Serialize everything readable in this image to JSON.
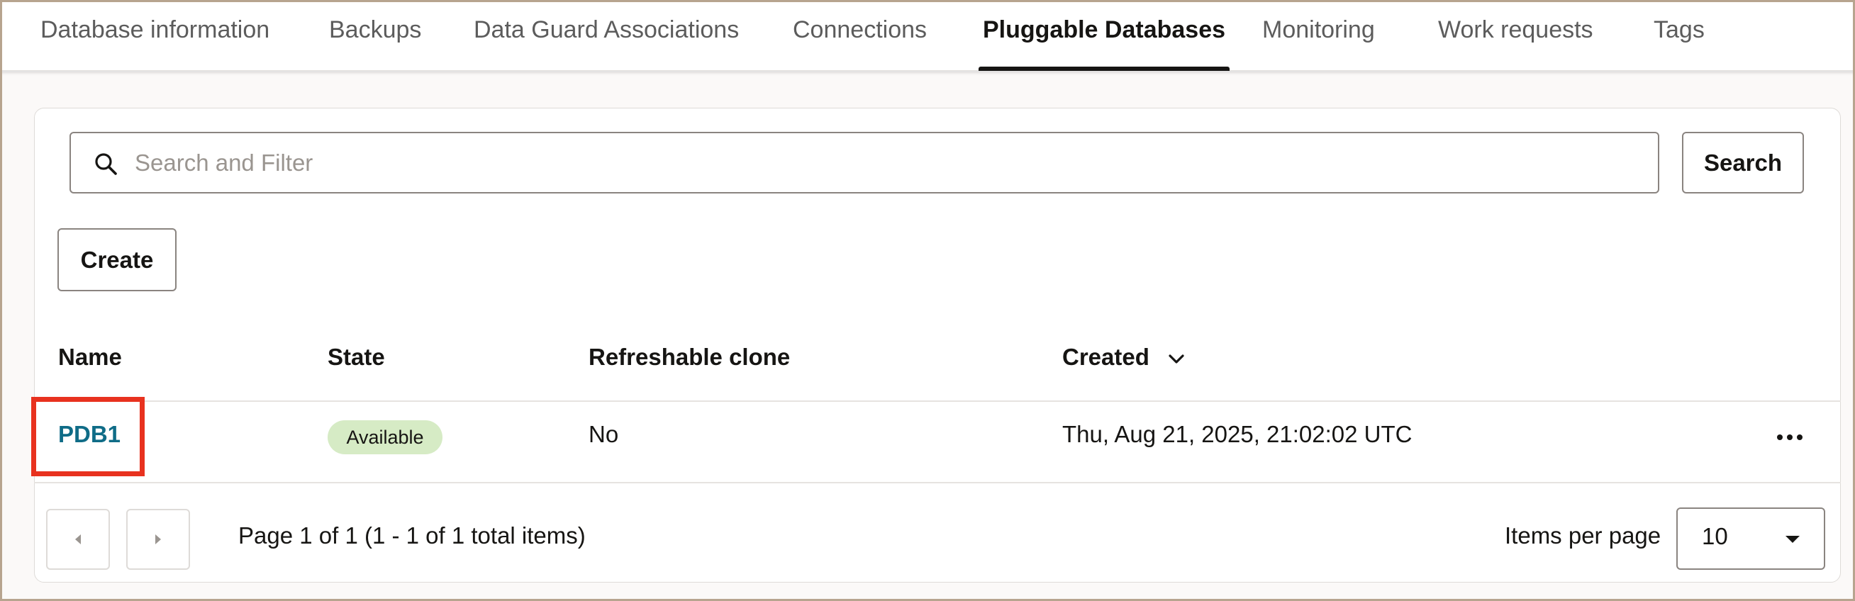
{
  "tabs": [
    {
      "label": "Database information"
    },
    {
      "label": "Backups"
    },
    {
      "label": "Data Guard Associations"
    },
    {
      "label": "Connections"
    },
    {
      "label": "Pluggable Databases",
      "active": true
    },
    {
      "label": "Monitoring"
    },
    {
      "label": "Work requests"
    },
    {
      "label": "Tags"
    }
  ],
  "search": {
    "placeholder": "Search and Filter",
    "value": "",
    "button_label": "Search",
    "icon": "search-icon"
  },
  "toolbar": {
    "create_label": "Create"
  },
  "table": {
    "columns": [
      "Name",
      "State",
      "Refreshable clone",
      "Created"
    ],
    "sorted_column": "Created",
    "sort_icon": "chevron-down-icon",
    "rows": [
      {
        "name": "PDB1",
        "state": "Available",
        "refreshable_clone": "No",
        "created": "Thu, Aug 21, 2025, 21:02:02 UTC",
        "actions_icon": "more-actions-icon"
      }
    ]
  },
  "pagination": {
    "summary": "Page 1 of 1 (1 - 1 of 1 total items)",
    "items_per_page_label": "Items per page",
    "items_per_page": "10"
  },
  "colors": {
    "link": "#0f6c87",
    "badge_available": "#d6ebc5",
    "highlight": "#e8321f",
    "frame": "#b7a48f"
  }
}
